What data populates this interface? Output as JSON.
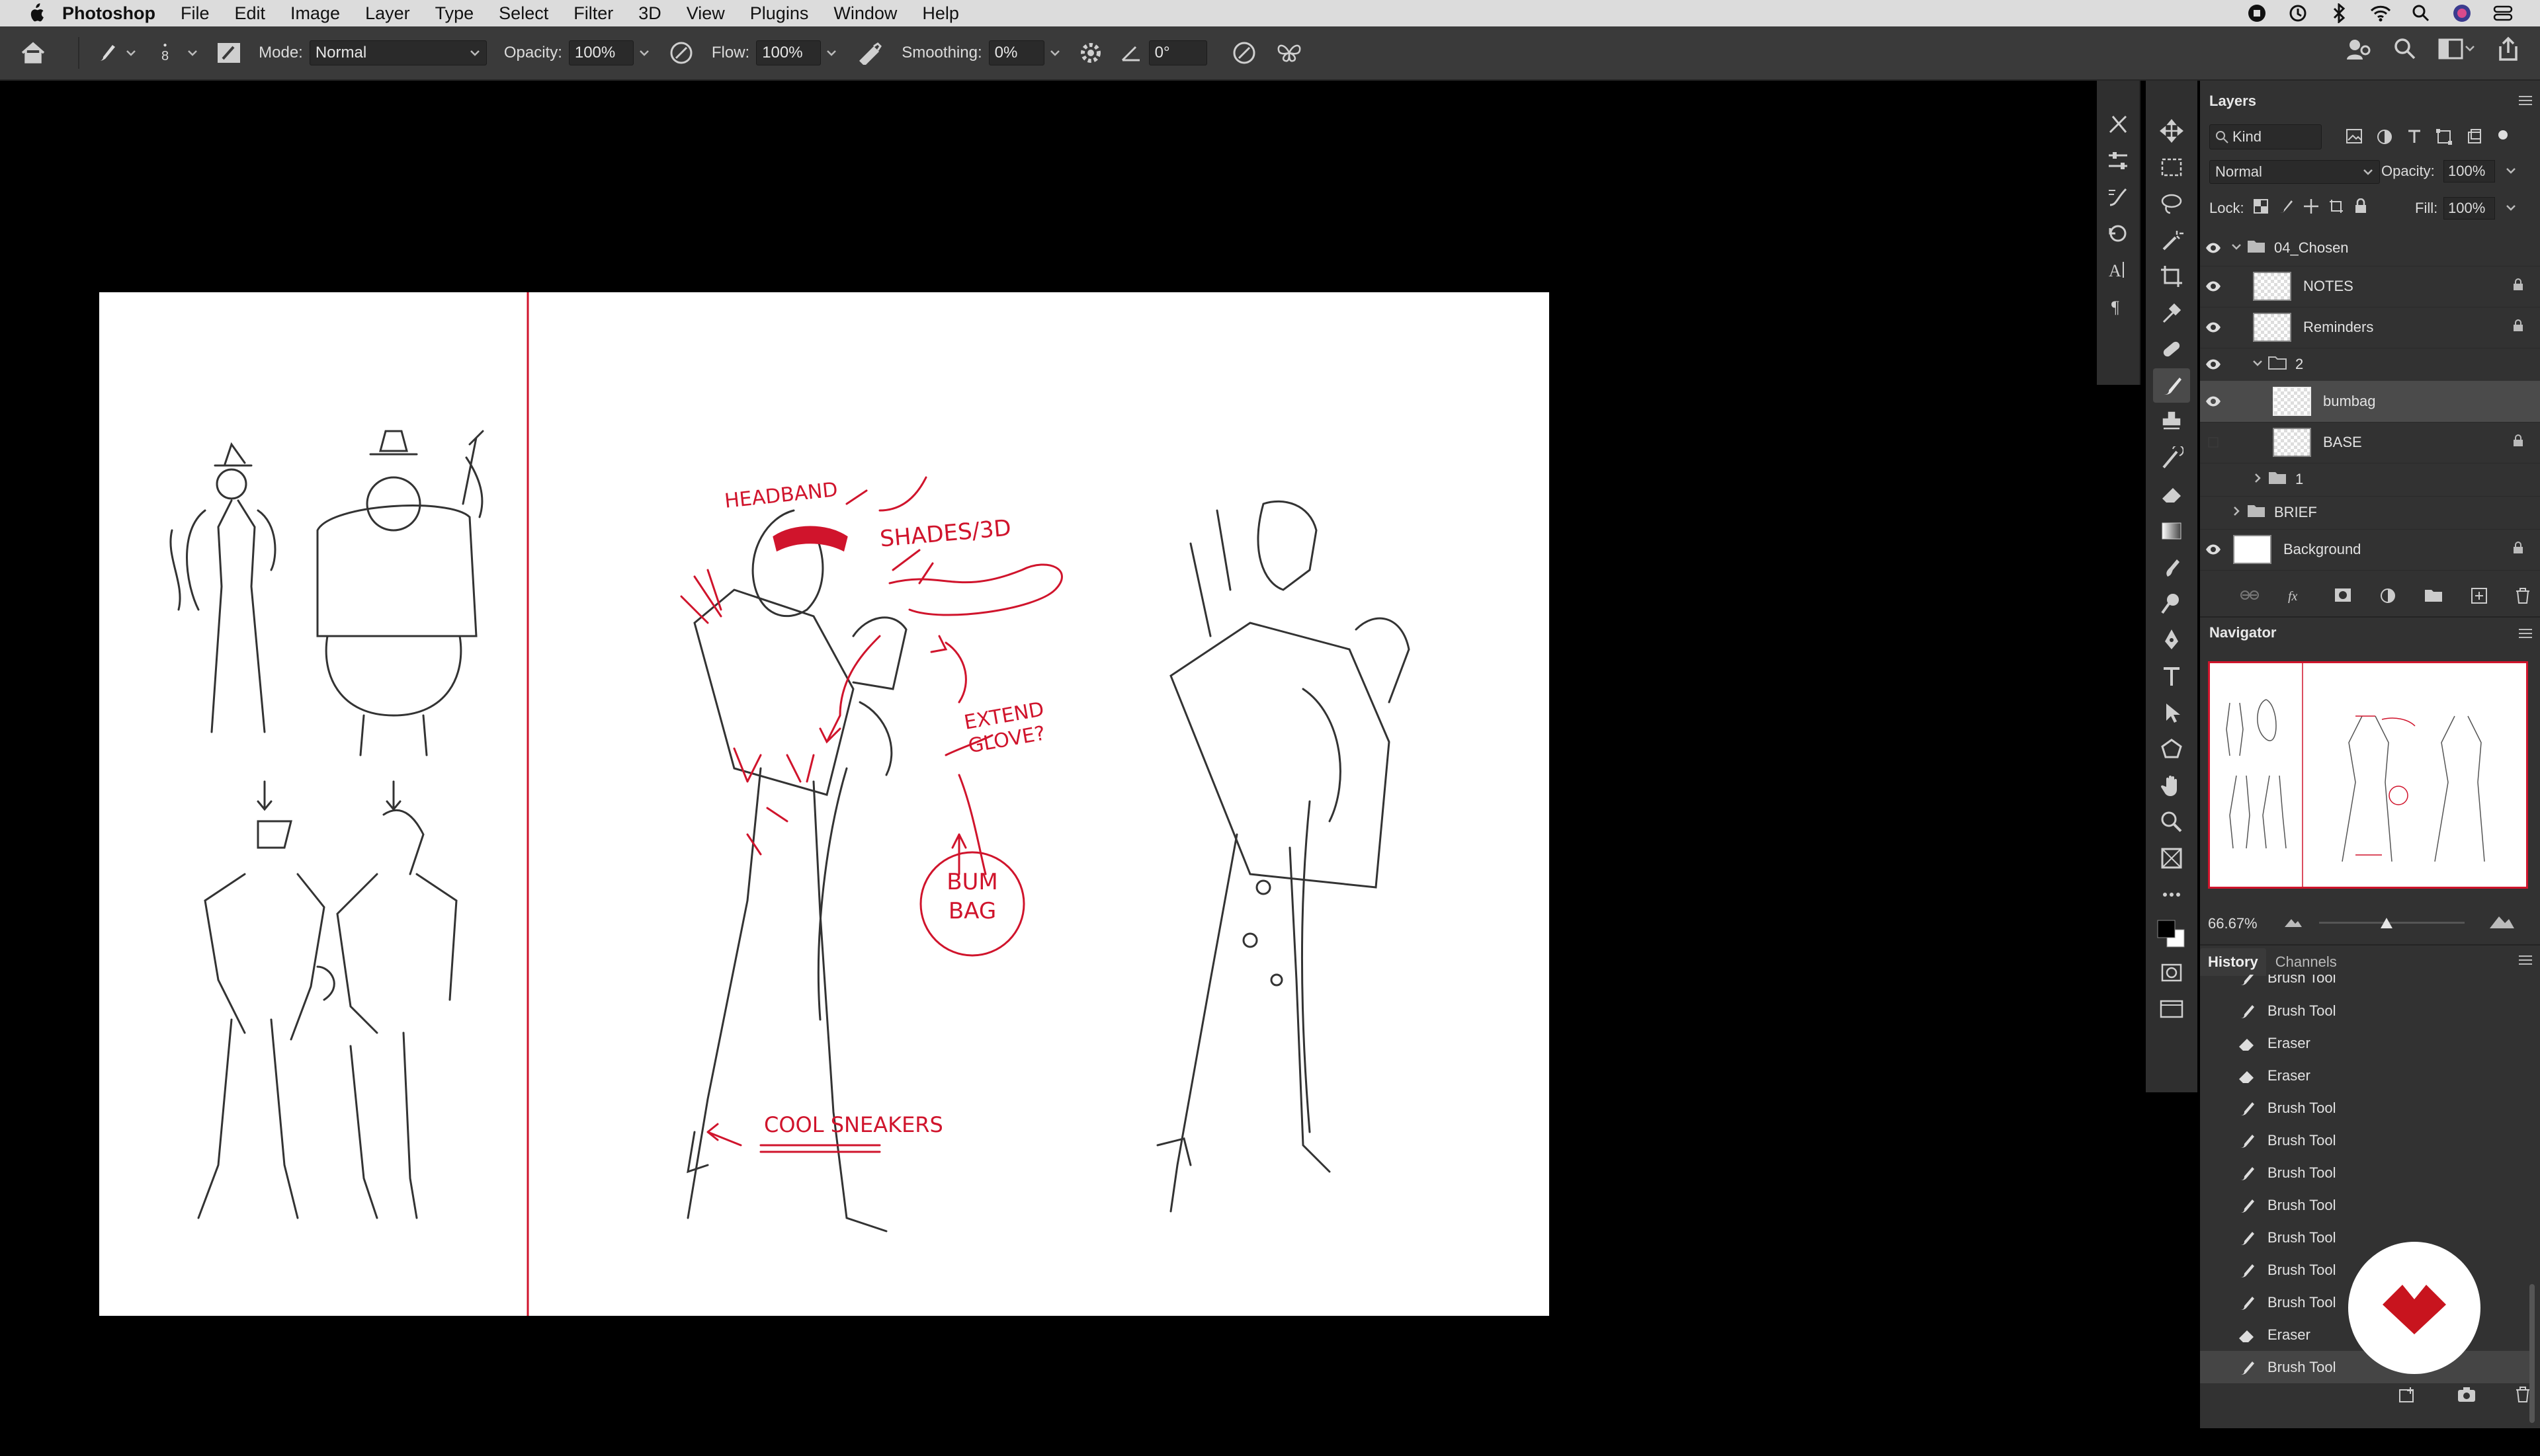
{
  "menubar": {
    "app_name": "Photoshop",
    "items": [
      "File",
      "Edit",
      "Image",
      "Layer",
      "Type",
      "Select",
      "Filter",
      "3D",
      "View",
      "Plugins",
      "Window",
      "Help"
    ]
  },
  "options": {
    "brush_size": "8",
    "mode_label": "Mode:",
    "mode_value": "Normal",
    "opacity_label": "Opacity:",
    "opacity_value": "100%",
    "flow_label": "Flow:",
    "flow_value": "100%",
    "smoothing_label": "Smoothing:",
    "smoothing_value": "0%",
    "angle_value": "0°"
  },
  "canvas_annotations": {
    "headband": "HEADBAND",
    "shades": "SHADES/3D",
    "extend_glove": "EXTEND GLOVE?",
    "bum_bag": "BUM BAG",
    "cool_sneakers": "COOL SNEAKERS"
  },
  "layers_panel": {
    "title": "Layers",
    "kind_label": "Kind",
    "blend_mode": "Normal",
    "opacity_label": "Opacity:",
    "opacity_value": "100%",
    "lock_label": "Lock:",
    "fill_label": "Fill:",
    "fill_value": "100%",
    "layers": [
      {
        "name": "04_Chosen",
        "type": "group",
        "visible": true,
        "locked": false,
        "expanded": true
      },
      {
        "name": "NOTES",
        "type": "layer",
        "visible": true,
        "locked": true
      },
      {
        "name": "Reminders",
        "type": "layer",
        "visible": true,
        "locked": true
      },
      {
        "name": "2",
        "type": "group",
        "visible": true,
        "locked": false,
        "expanded": true
      },
      {
        "name": "bumbag",
        "type": "layer",
        "visible": true,
        "locked": false,
        "selected": true
      },
      {
        "name": "BASE",
        "type": "layer",
        "visible": false,
        "locked": true
      },
      {
        "name": "1",
        "type": "group",
        "visible": false,
        "locked": false,
        "expanded": false
      },
      {
        "name": "BRIEF",
        "type": "group",
        "visible": false,
        "locked": false,
        "expanded": false
      },
      {
        "name": "Background",
        "type": "layer",
        "visible": true,
        "locked": true
      }
    ]
  },
  "navigator": {
    "title": "Navigator",
    "zoom": "66.67%"
  },
  "history_panel": {
    "tab_history": "History",
    "tab_channels": "Channels",
    "items": [
      {
        "label": "Brush Tool",
        "icon": "brush"
      },
      {
        "label": "Brush Tool",
        "icon": "brush"
      },
      {
        "label": "Eraser",
        "icon": "eraser"
      },
      {
        "label": "Eraser",
        "icon": "eraser"
      },
      {
        "label": "Brush Tool",
        "icon": "brush"
      },
      {
        "label": "Brush Tool",
        "icon": "brush"
      },
      {
        "label": "Brush Tool",
        "icon": "brush"
      },
      {
        "label": "Brush Tool",
        "icon": "brush"
      },
      {
        "label": "Brush Tool",
        "icon": "brush"
      },
      {
        "label": "Brush Tool",
        "icon": "brush"
      },
      {
        "label": "Brush Tool",
        "icon": "brush"
      },
      {
        "label": "Eraser",
        "icon": "eraser"
      },
      {
        "label": "Brush Tool",
        "icon": "brush"
      }
    ]
  },
  "colors": {
    "accent_red": "#d0142c",
    "panel_bg": "#323232"
  }
}
